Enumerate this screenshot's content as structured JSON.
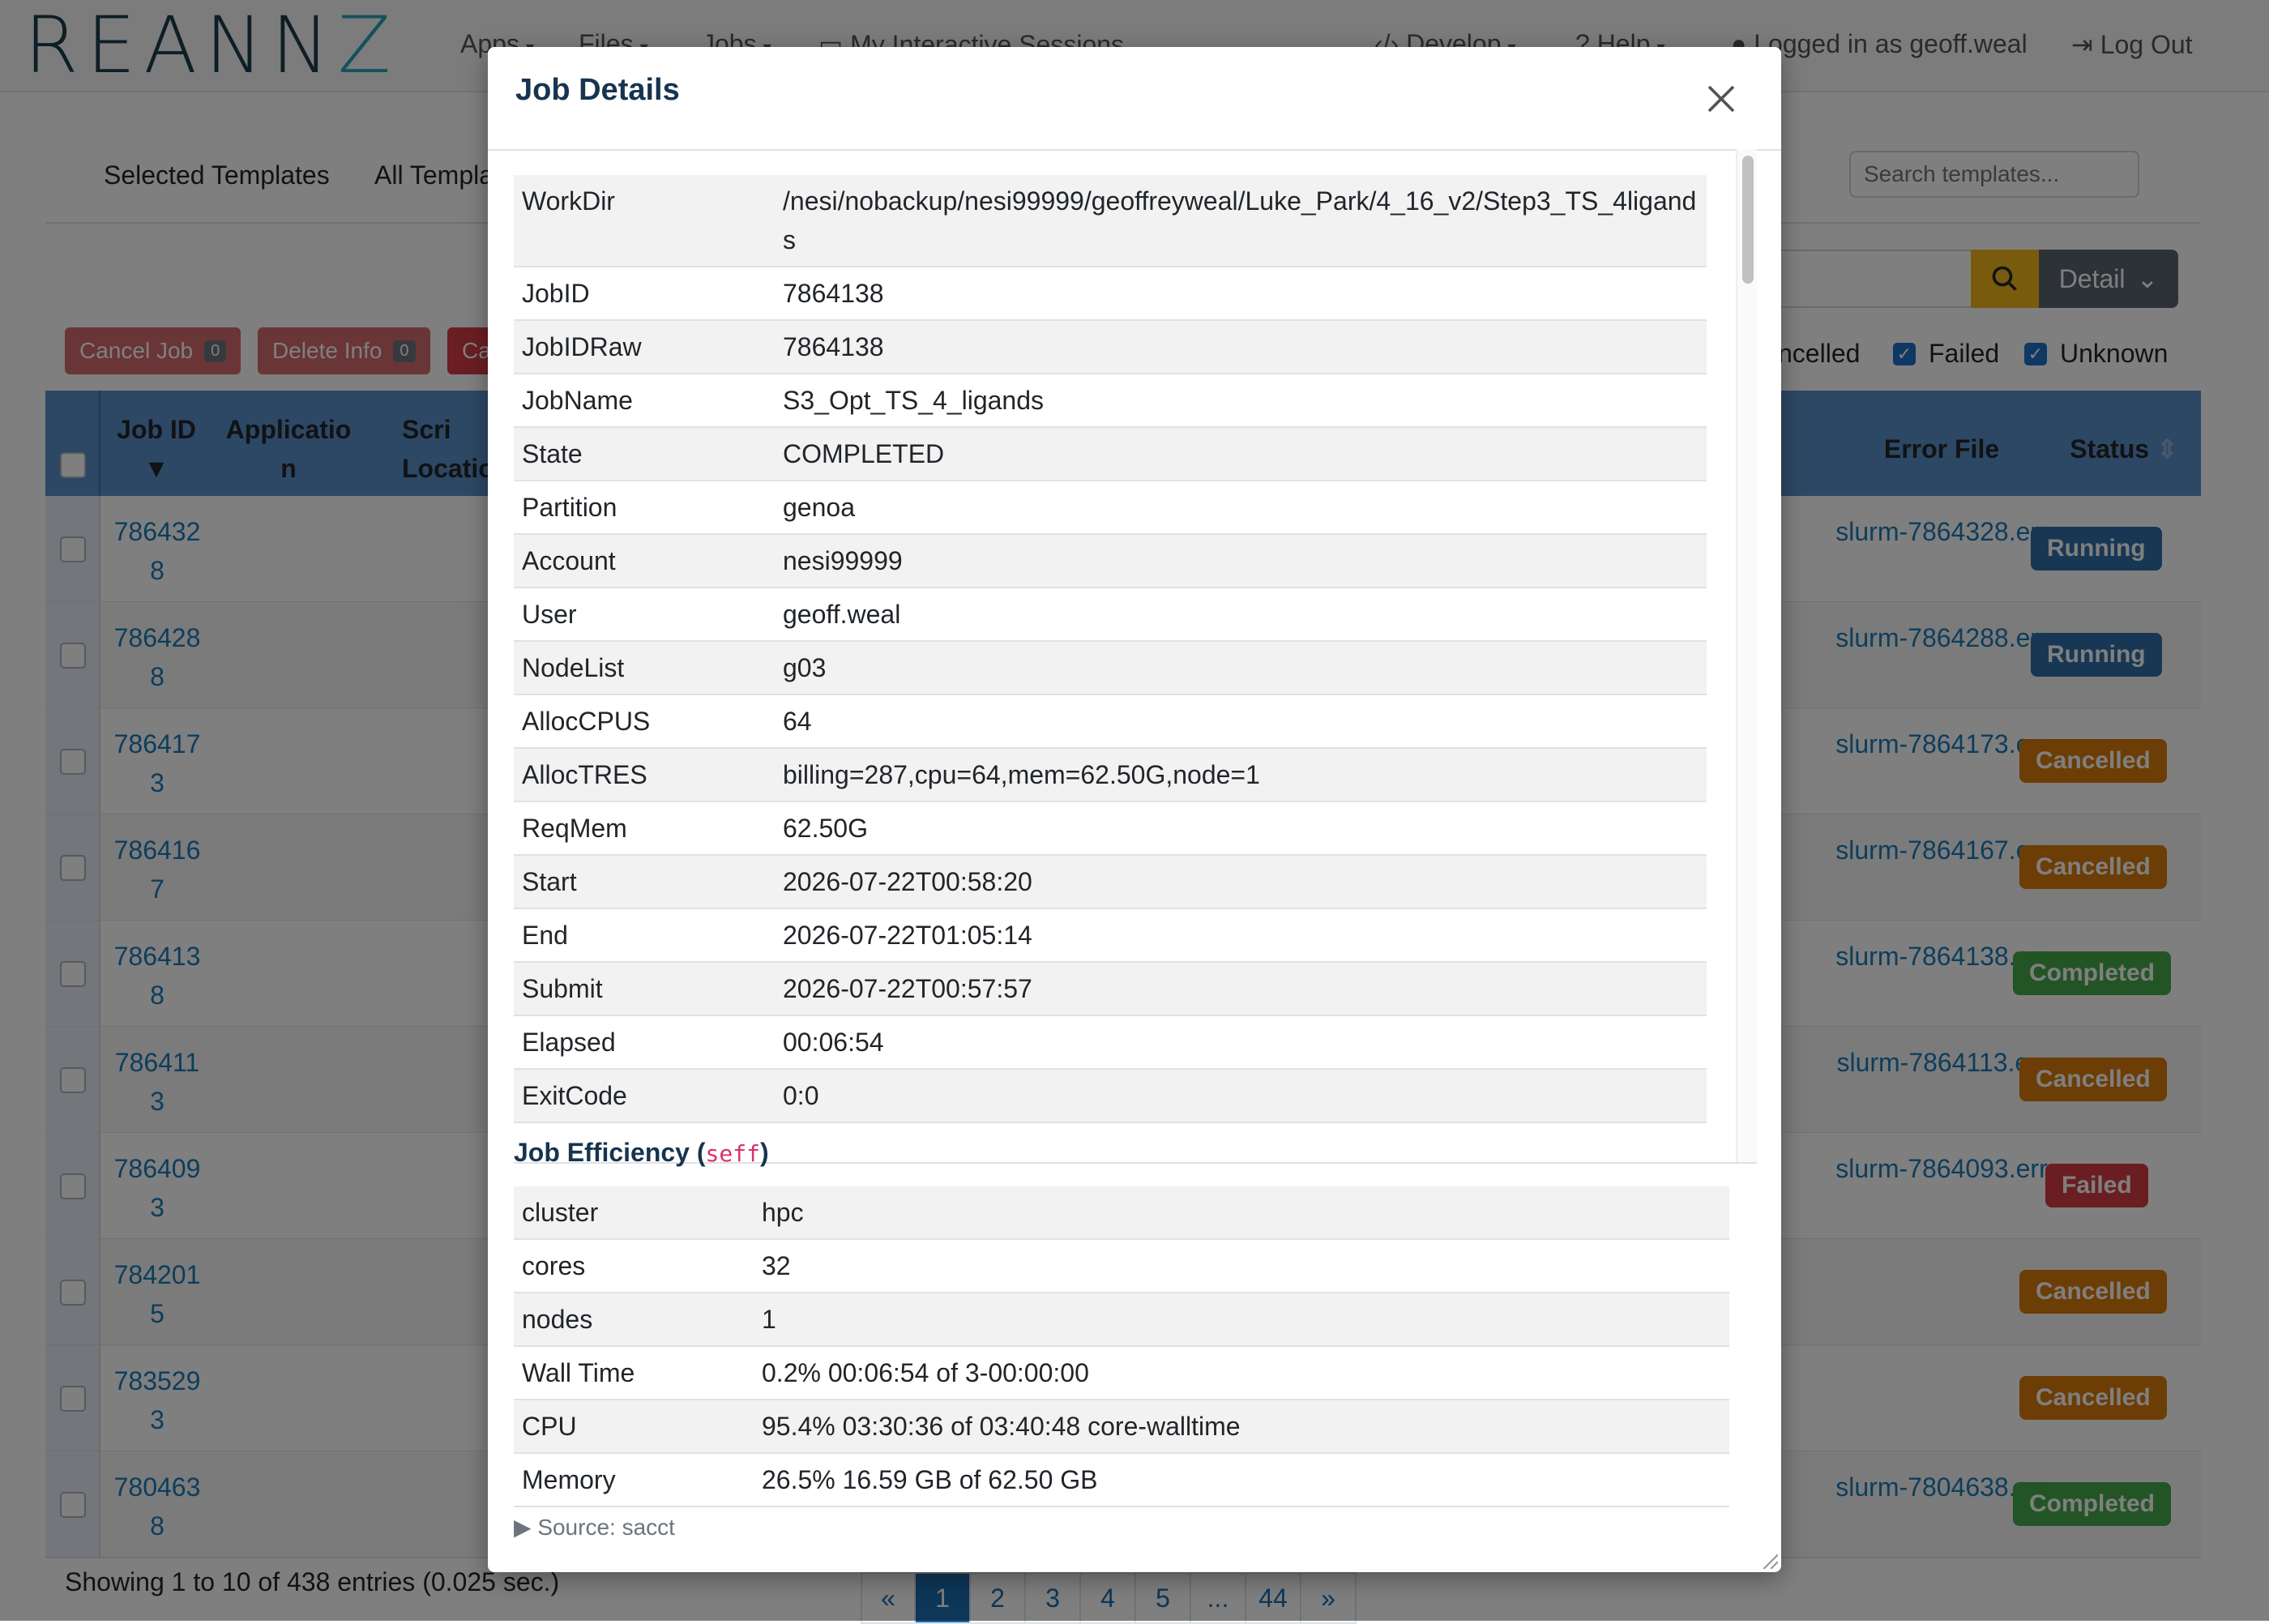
{
  "navbar": {
    "logo_left": "REANN",
    "logo_right": "Z",
    "items": [
      "Apps",
      "Files",
      "Jobs",
      "My Interactive Sessions",
      "Develop",
      "Help",
      "Logged in as geoff.weal",
      "Log Out"
    ]
  },
  "page": {
    "tabs": [
      "Selected Templates",
      "All Templa"
    ],
    "template_search_placeholder": "Search templates...",
    "detail_label": "Detail",
    "actions": [
      {
        "label": "Cancel Job",
        "count": "0"
      },
      {
        "label": "Delete Info",
        "count": "0"
      },
      {
        "label": "Ca",
        "count": ""
      }
    ],
    "filters": [
      {
        "label": "ncelled",
        "checked": true
      },
      {
        "label": "Failed",
        "checked": true
      },
      {
        "label": "Unknown",
        "checked": true
      }
    ],
    "columns": [
      "Job ID",
      "Applicatio n",
      "Scri Locatio",
      "Error File",
      "Status"
    ],
    "rows": [
      {
        "job_id": "7864328",
        "err": "slurm-7864328.err",
        "status": "Running"
      },
      {
        "job_id": "7864288",
        "err": "slurm-7864288.err",
        "status": "Running"
      },
      {
        "job_id": "7864173",
        "err": "slurm-7864173.err",
        "status": "Cancelled"
      },
      {
        "job_id": "7864167",
        "err": "slurm-7864167.err",
        "status": "Cancelled"
      },
      {
        "job_id": "7864138",
        "err": "slurm-7864138.err",
        "status": "Completed"
      },
      {
        "job_id": "7864113",
        "err": "slurm-7864113.err",
        "status": "Cancelled"
      },
      {
        "job_id": "7864093",
        "err": "slurm-7864093.err",
        "status": "Failed"
      },
      {
        "job_id": "7842015",
        "err": "",
        "status": "Cancelled"
      },
      {
        "job_id": "7835293",
        "err": "",
        "status": "Cancelled"
      },
      {
        "job_id": "7804638",
        "err": "slurm-7804638.err",
        "status": "Completed"
      }
    ],
    "footer": "Showing 1 to 10 of 438 entries (0.025 sec.)",
    "pagination": [
      "«",
      "1",
      "2",
      "3",
      "4",
      "5",
      "...",
      "44",
      "»"
    ],
    "active_page": "1"
  },
  "modal": {
    "title": "Job Details",
    "details": [
      {
        "key": "WorkDir",
        "value": "/nesi/nobackup/nesi99999/geoffreyweal/Luke_Park/4_16_v2/Step3_TS_4ligands"
      },
      {
        "key": "JobID",
        "value": "7864138"
      },
      {
        "key": "JobIDRaw",
        "value": "7864138"
      },
      {
        "key": "JobName",
        "value": "S3_Opt_TS_4_ligands"
      },
      {
        "key": "State",
        "value": "COMPLETED"
      },
      {
        "key": "Partition",
        "value": "genoa"
      },
      {
        "key": "Account",
        "value": "nesi99999"
      },
      {
        "key": "User",
        "value": "geoff.weal"
      },
      {
        "key": "NodeList",
        "value": "g03"
      },
      {
        "key": "AllocCPUS",
        "value": "64"
      },
      {
        "key": "AllocTRES",
        "value": "billing=287,cpu=64,mem=62.50G,node=1"
      },
      {
        "key": "ReqMem",
        "value": "62.50G"
      },
      {
        "key": "Start",
        "value": "2026-07-22T00:58:20"
      },
      {
        "key": "End",
        "value": "2026-07-22T01:05:14"
      },
      {
        "key": "Submit",
        "value": "2026-07-22T00:57:57"
      },
      {
        "key": "Elapsed",
        "value": "00:06:54"
      },
      {
        "key": "ExitCode",
        "value": "0:0"
      }
    ],
    "efficiency_title": "Job Efficiency (",
    "efficiency_code": "seff",
    "efficiency_close": ")",
    "efficiency": [
      {
        "key": "cluster",
        "value": "hpc"
      },
      {
        "key": "cores",
        "value": "32"
      },
      {
        "key": "nodes",
        "value": "1"
      },
      {
        "key": "Wall Time",
        "value": "0.2% 00:06:54 of 3-00:00:00"
      },
      {
        "key": "CPU",
        "value": "95.4% 03:30:36 of 03:40:48 core-walltime"
      },
      {
        "key": "Memory",
        "value": "26.5% 16.59 GB of 62.50 GB"
      }
    ],
    "source_label": "Source: sacct"
  },
  "colors": {
    "running": "#2f6ea8",
    "cancelled": "#d97a0a",
    "completed": "#47a84b",
    "failed": "#d63c45",
    "link": "#1a7ab8"
  }
}
